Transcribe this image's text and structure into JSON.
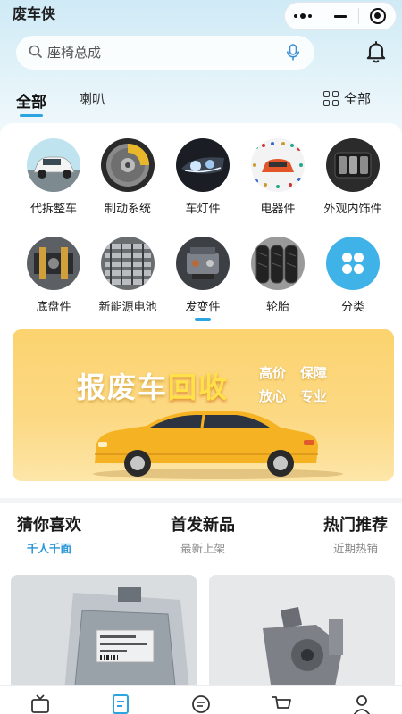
{
  "app": {
    "title": "废车侠"
  },
  "search": {
    "placeholder": "座椅总成"
  },
  "category_tabs": [
    {
      "label": "全部",
      "active": true
    },
    {
      "label": "喇叭",
      "active": false
    }
  ],
  "all_button": {
    "label": "全部"
  },
  "icon_grid": [
    {
      "label": "代拆整车",
      "icon": "white-suv-photo"
    },
    {
      "label": "制动系统",
      "icon": "brake-disc-photo"
    },
    {
      "label": "车灯件",
      "icon": "headlight-photo"
    },
    {
      "label": "电器件",
      "icon": "car-parts-diagram-photo"
    },
    {
      "label": "外观内饰件",
      "icon": "window-switch-photo"
    },
    {
      "label": "底盘件",
      "icon": "chassis-photo"
    },
    {
      "label": "新能源电池",
      "icon": "battery-cells-photo"
    },
    {
      "label": "发变件",
      "icon": "engine-photo",
      "active": true
    },
    {
      "label": "轮胎",
      "icon": "tires-photo"
    },
    {
      "label": "分类",
      "icon": "four-dots-icon"
    }
  ],
  "banner": {
    "title_main": "报废车",
    "title_highlight": "回收",
    "tags": [
      "高价",
      "保障",
      "放心",
      "专业"
    ]
  },
  "recommend_tabs": [
    {
      "title": "猜你喜欢",
      "subtitle": "千人千面",
      "active": true
    },
    {
      "title": "首发新品",
      "subtitle": "最新上架",
      "active": false
    },
    {
      "title": "热门推荐",
      "subtitle": "近期热销",
      "active": false
    }
  ],
  "products": [
    {
      "image": "ecu-module-photo"
    },
    {
      "image": "metal-part-photo"
    }
  ],
  "bottom_nav": [
    {
      "icon": "tv-icon"
    },
    {
      "icon": "document-icon",
      "active": true
    },
    {
      "icon": "message-icon"
    },
    {
      "icon": "cart-icon"
    },
    {
      "icon": "profile-icon"
    }
  ],
  "colors": {
    "accent": "#2aa5e0",
    "banner": "#fbd36f",
    "car": "#f5b324"
  }
}
